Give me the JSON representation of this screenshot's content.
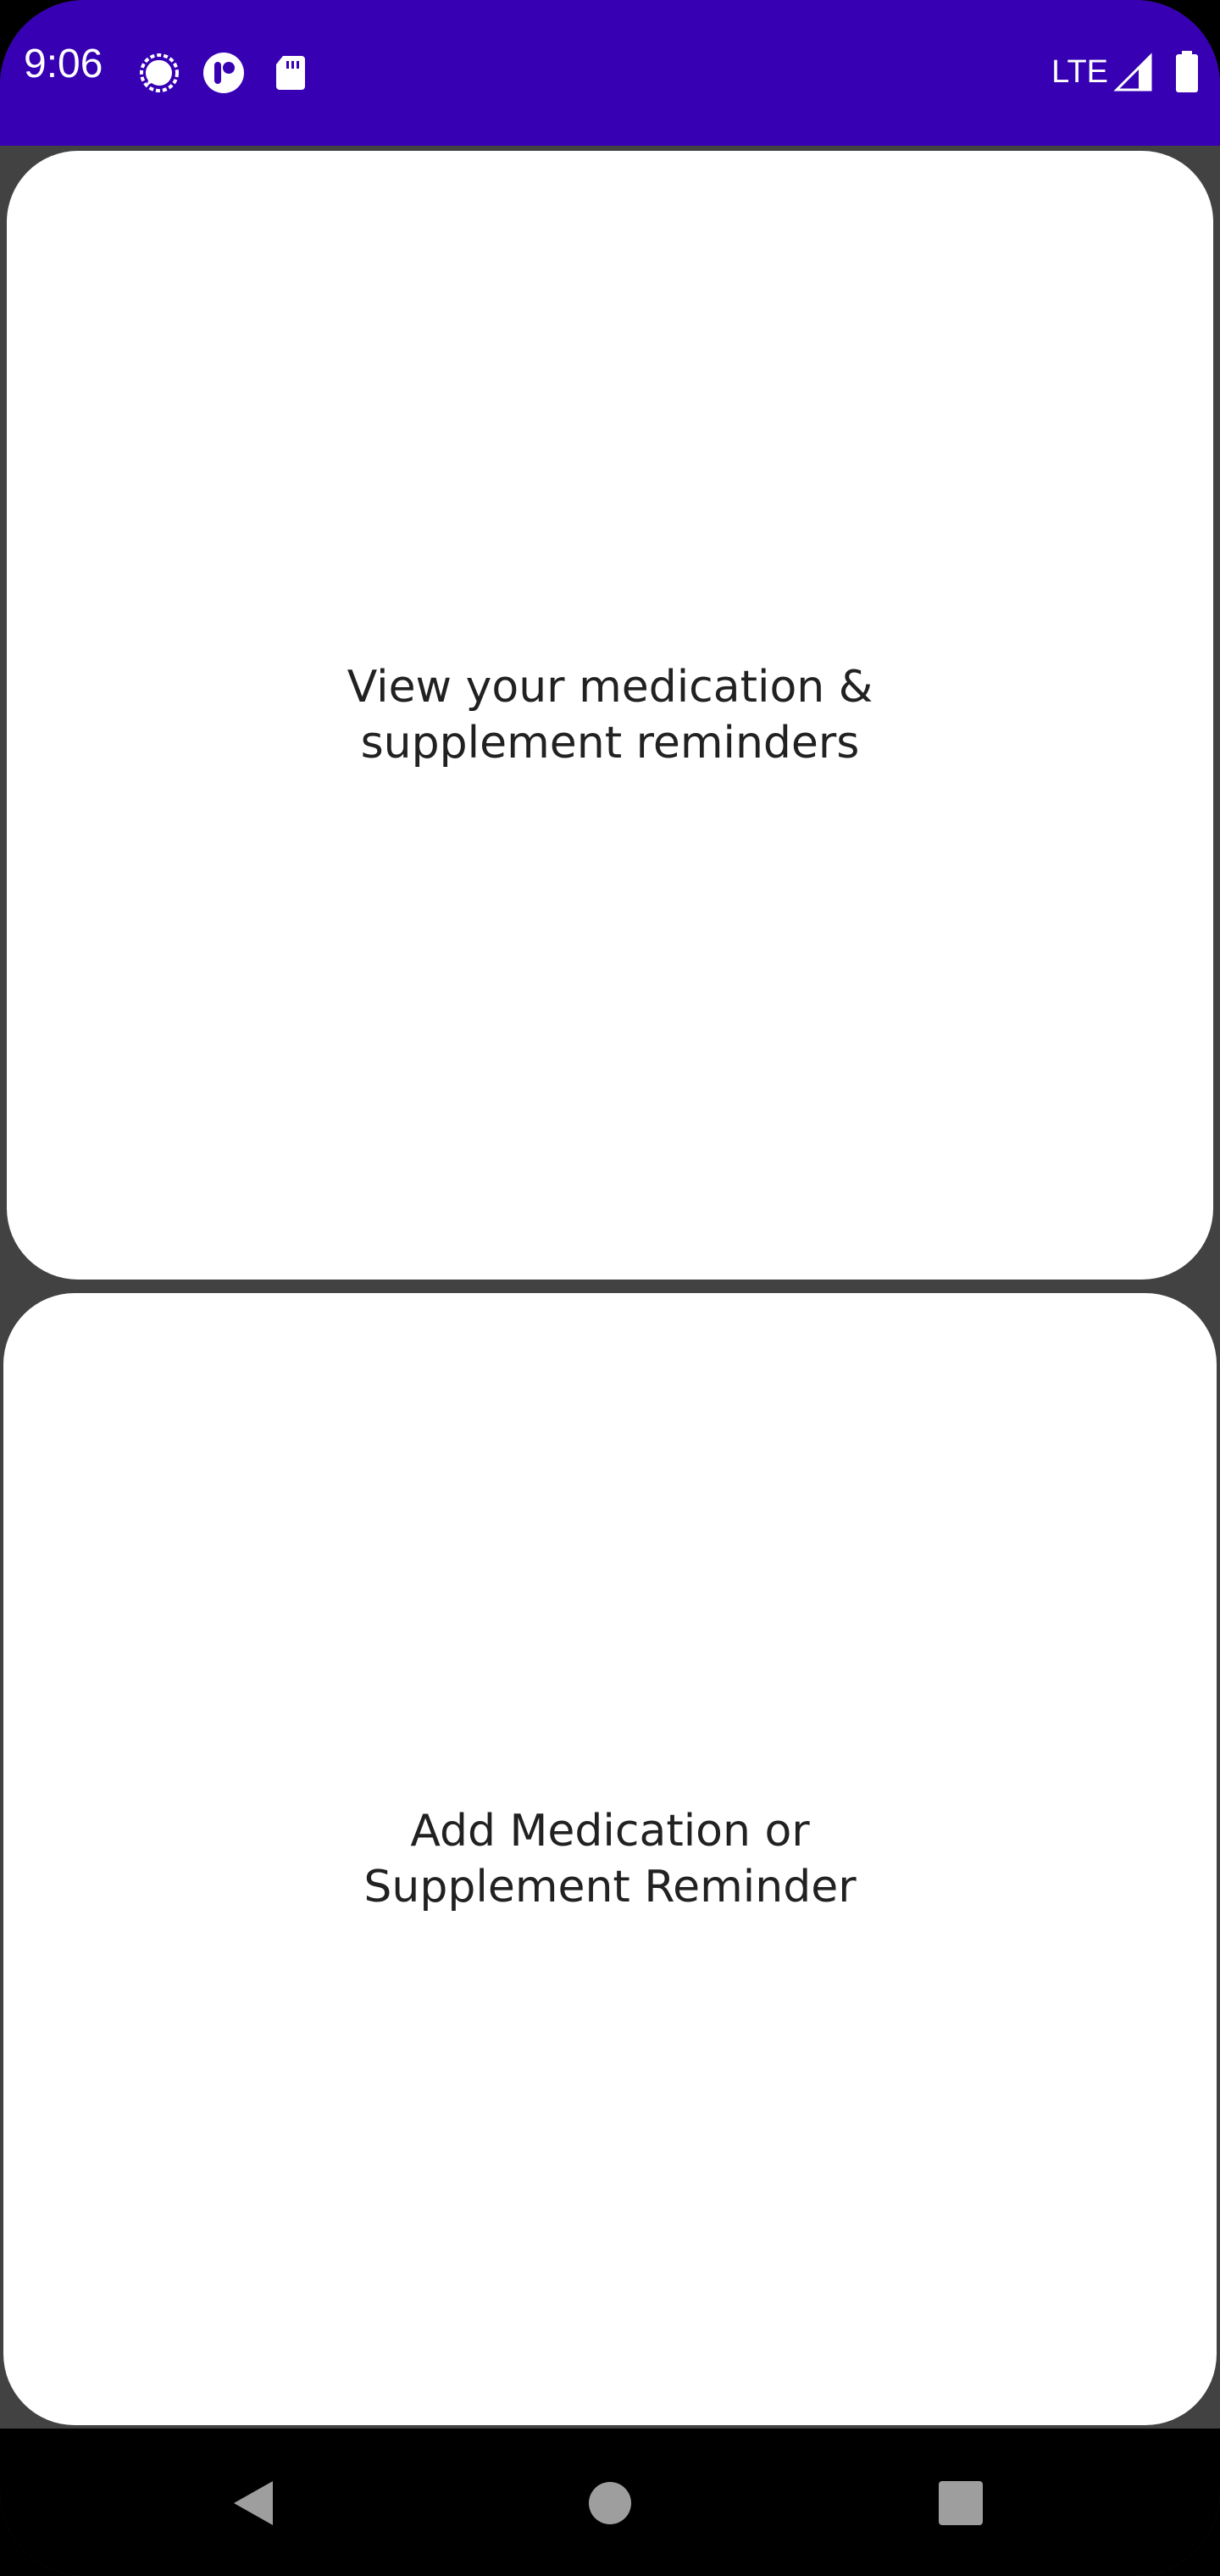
{
  "status_bar": {
    "time": "9:06",
    "network": "LTE",
    "background_color": "#3700b3",
    "icons": [
      "signal-messenger-icon",
      "app-notification-icon",
      "sd-card-icon",
      "cell-signal-icon",
      "battery-icon"
    ]
  },
  "main": {
    "background_color": "#424242",
    "cards": [
      {
        "label": "View your medication &\nsupplement reminders"
      },
      {
        "label": "Add Medication or\nSupplement Reminder"
      }
    ]
  },
  "navigation_bar": {
    "buttons": [
      "back-button",
      "home-button",
      "recents-button"
    ]
  }
}
